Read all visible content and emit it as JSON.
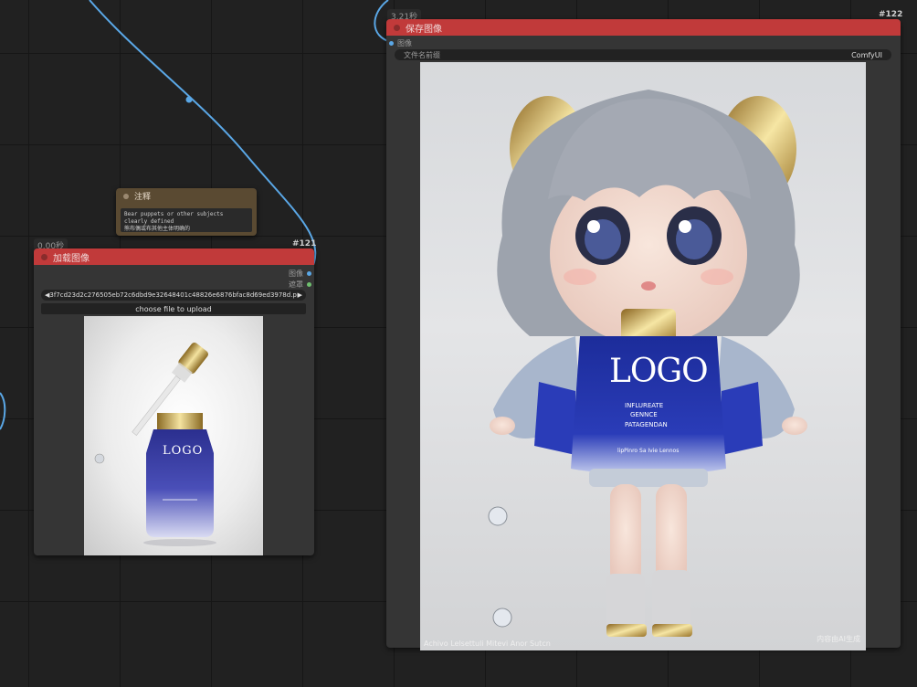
{
  "load_node": {
    "exec_time": "0.00秒",
    "id": "#121",
    "title": "加载图像",
    "outputs": [
      "图像",
      "遮罩"
    ],
    "filename": "3f7cd23d2c276505eb72c6dbd9e32648401c48826e6876bfac8d69ed3978d.png",
    "upload_label": "choose file to upload",
    "image_desc": "serum-dropper-bottle",
    "bottle_logo": "LOGO"
  },
  "note_node": {
    "title": "注释",
    "text_line1": "Bear puppets or other subjects clearly defined",
    "text_line2": "熊布偶或布其他主体明确的"
  },
  "save_node": {
    "exec_time": "3.21秒",
    "id": "#122",
    "title": "保存图像",
    "input_label": "图像",
    "prefix_label": "文件名前缀",
    "prefix_value": "ComfyUI",
    "shirt_logo": "LOGO",
    "shirt_text1": "INFLUREATE",
    "shirt_text2": "GENNCE",
    "shirt_text3": "PATAGENDAN",
    "shirt_text4": "lipPinro Sa Ivie Lennos",
    "watermark_left": "Achivo Lelsettuli Mitevi Anor Sutcn",
    "watermark_right": "内容由AI生成"
  },
  "colors": {
    "node_header": "#c13a3a",
    "node_body": "#353535",
    "wire": "#5aa7e6",
    "note_bg": "#5a4a32",
    "canvas": "#212121"
  }
}
